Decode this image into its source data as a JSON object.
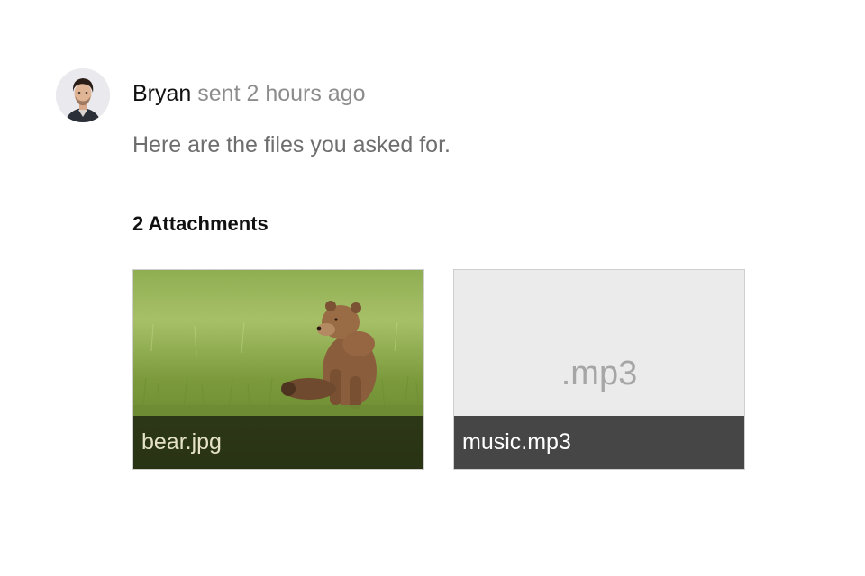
{
  "comment": {
    "author": "Bryan",
    "time_text": "sent 2 hours ago",
    "message": "Here are the files you asked for.",
    "avatar_icon": "user-avatar-photo"
  },
  "attachments": {
    "title": "2 Attachments",
    "items": [
      {
        "name": "bear.jpg",
        "kind": "image",
        "preview": "bear-in-grass-photo"
      },
      {
        "name": "music.mp3",
        "kind": "file",
        "extension_label": ".mp3"
      }
    ]
  },
  "colors": {
    "author": "#111111",
    "muted_text": "#8c8c8c",
    "message_text": "#6e6e6e",
    "file_preview_bg": "#ebebeb",
    "file_caption_bg": "#464646"
  }
}
